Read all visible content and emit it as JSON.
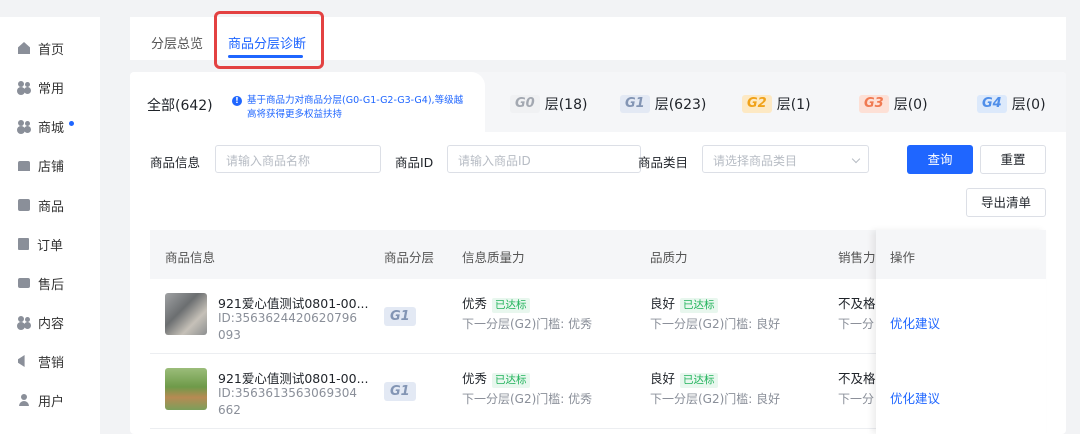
{
  "sidebar": {
    "items": [
      {
        "label": "首页",
        "icon": "home-icon"
      },
      {
        "label": "常用",
        "icon": "people-icon"
      },
      {
        "label": "商城",
        "icon": "people-icon"
      },
      {
        "label": "店铺",
        "icon": "shop-icon"
      },
      {
        "label": "商品",
        "icon": "box-icon"
      },
      {
        "label": "订单",
        "icon": "doc-icon"
      },
      {
        "label": "售后",
        "icon": "inbox-icon"
      },
      {
        "label": "内容",
        "icon": "people-icon"
      },
      {
        "label": "营销",
        "icon": "megaphone-icon"
      },
      {
        "label": "用户",
        "icon": "user-icon"
      }
    ]
  },
  "tabs": [
    {
      "label": "分层总览"
    },
    {
      "label": "商品分层诊断",
      "active": true
    }
  ],
  "tiers": {
    "all_label": "全部(642)",
    "note": "基于商品力对商品分层(G0-G1-G2-G3-G4),等级越高将获得更多权益扶持",
    "items": [
      {
        "badge": "G0",
        "label": "层(18)"
      },
      {
        "badge": "G1",
        "label": "层(623)"
      },
      {
        "badge": "G2",
        "label": "层(1)"
      },
      {
        "badge": "G3",
        "label": "层(0)"
      },
      {
        "badge": "G4",
        "label": "层(0)"
      }
    ]
  },
  "filters": {
    "info_label": "商品信息",
    "info_placeholder": "请输入商品名称",
    "id_label": "商品ID",
    "id_placeholder": "请输入商品ID",
    "category_label": "商品类目",
    "category_placeholder": "请选择商品类目",
    "search_btn": "查询",
    "reset_btn": "重置",
    "export_btn": "导出清单"
  },
  "table": {
    "columns": [
      "商品信息",
      "商品分层",
      "信息质量力",
      "品质力",
      "销售力",
      "操作"
    ],
    "rows": [
      {
        "name": "921爱心值测试0801-00...",
        "id": "ID:3563624420620796093",
        "tier": "G1",
        "info_quality": "优秀",
        "info_tag": "已达标",
        "info_next": "下一分层(G2)门槛: 优秀",
        "quality": "良好",
        "quality_tag": "已达标",
        "quality_next": "下一分层(G2)门槛: 良好",
        "sales": "不及格",
        "sales_next": "下一分",
        "action": "优化建议"
      },
      {
        "name": "921爱心值测试0801-00...",
        "id": "ID:3563613563069304662",
        "tier": "G1",
        "info_quality": "优秀",
        "info_tag": "已达标",
        "info_next": "下一分层(G2)门槛: 优秀",
        "quality": "良好",
        "quality_tag": "已达标",
        "quality_next": "下一分层(G2)门槛: 良好",
        "sales": "不及格",
        "sales_next": "下一分",
        "action": "优化建议"
      }
    ]
  },
  "colors": {
    "accent": "#1f66ff",
    "highlight_box": "#e34141",
    "success": "#21b35b"
  }
}
